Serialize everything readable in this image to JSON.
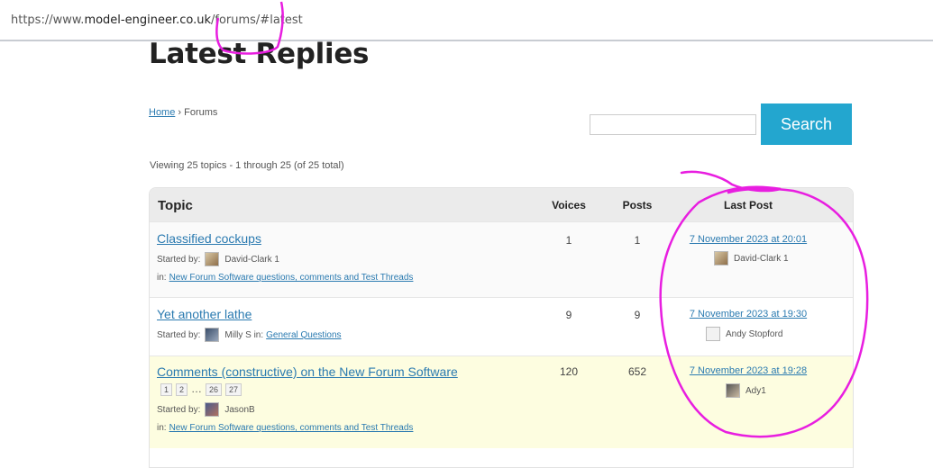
{
  "browser": {
    "url_prefix": "https://www.",
    "url_host": "model-engineer.co.uk",
    "url_path": "/forums/#latest"
  },
  "page": {
    "title": "Latest Replies",
    "breadcrumb_home": "Home",
    "breadcrumb_sep": "›",
    "breadcrumb_current": "Forums",
    "search_button": "Search",
    "search_placeholder": "",
    "viewing": "Viewing 25 topics - 1 through 25 (of 25 total)"
  },
  "table": {
    "headers": {
      "topic": "Topic",
      "voices": "Voices",
      "posts": "Posts",
      "last_post": "Last Post"
    },
    "rows": [
      {
        "title": "Classified cockups",
        "started_by_label": "Started by:",
        "author": "David-Clark 1",
        "in_label": "in:",
        "forum": "New Forum Software questions, comments and Test Threads",
        "voices": "1",
        "posts": "1",
        "last_date": "7 November 2023 at 20:01",
        "last_user": "David-Clark 1"
      },
      {
        "title": "Yet another lathe",
        "started_by_label": "Started by:",
        "author": "Milly S in:",
        "forum": "General Questions",
        "voices": "9",
        "posts": "9",
        "last_date": "7 November 2023 at 19:30",
        "last_user": "Andy Stopford"
      },
      {
        "title": "Comments (constructive) on the New Forum Software",
        "pages": [
          "1",
          "2",
          "…",
          "26",
          "27"
        ],
        "started_by_label": "Started by:",
        "author": "JasonB",
        "in_label": "in:",
        "forum": "New Forum Software questions, comments and Test Threads",
        "voices": "120",
        "posts": "652",
        "last_date": "7 November 2023 at 19:28",
        "last_user": "Ady1"
      }
    ]
  },
  "colors": {
    "accent": "#23a6cf",
    "link": "#2a7ab0",
    "sticky_row": "#fdfde0",
    "annotation": "#e81ee0"
  }
}
